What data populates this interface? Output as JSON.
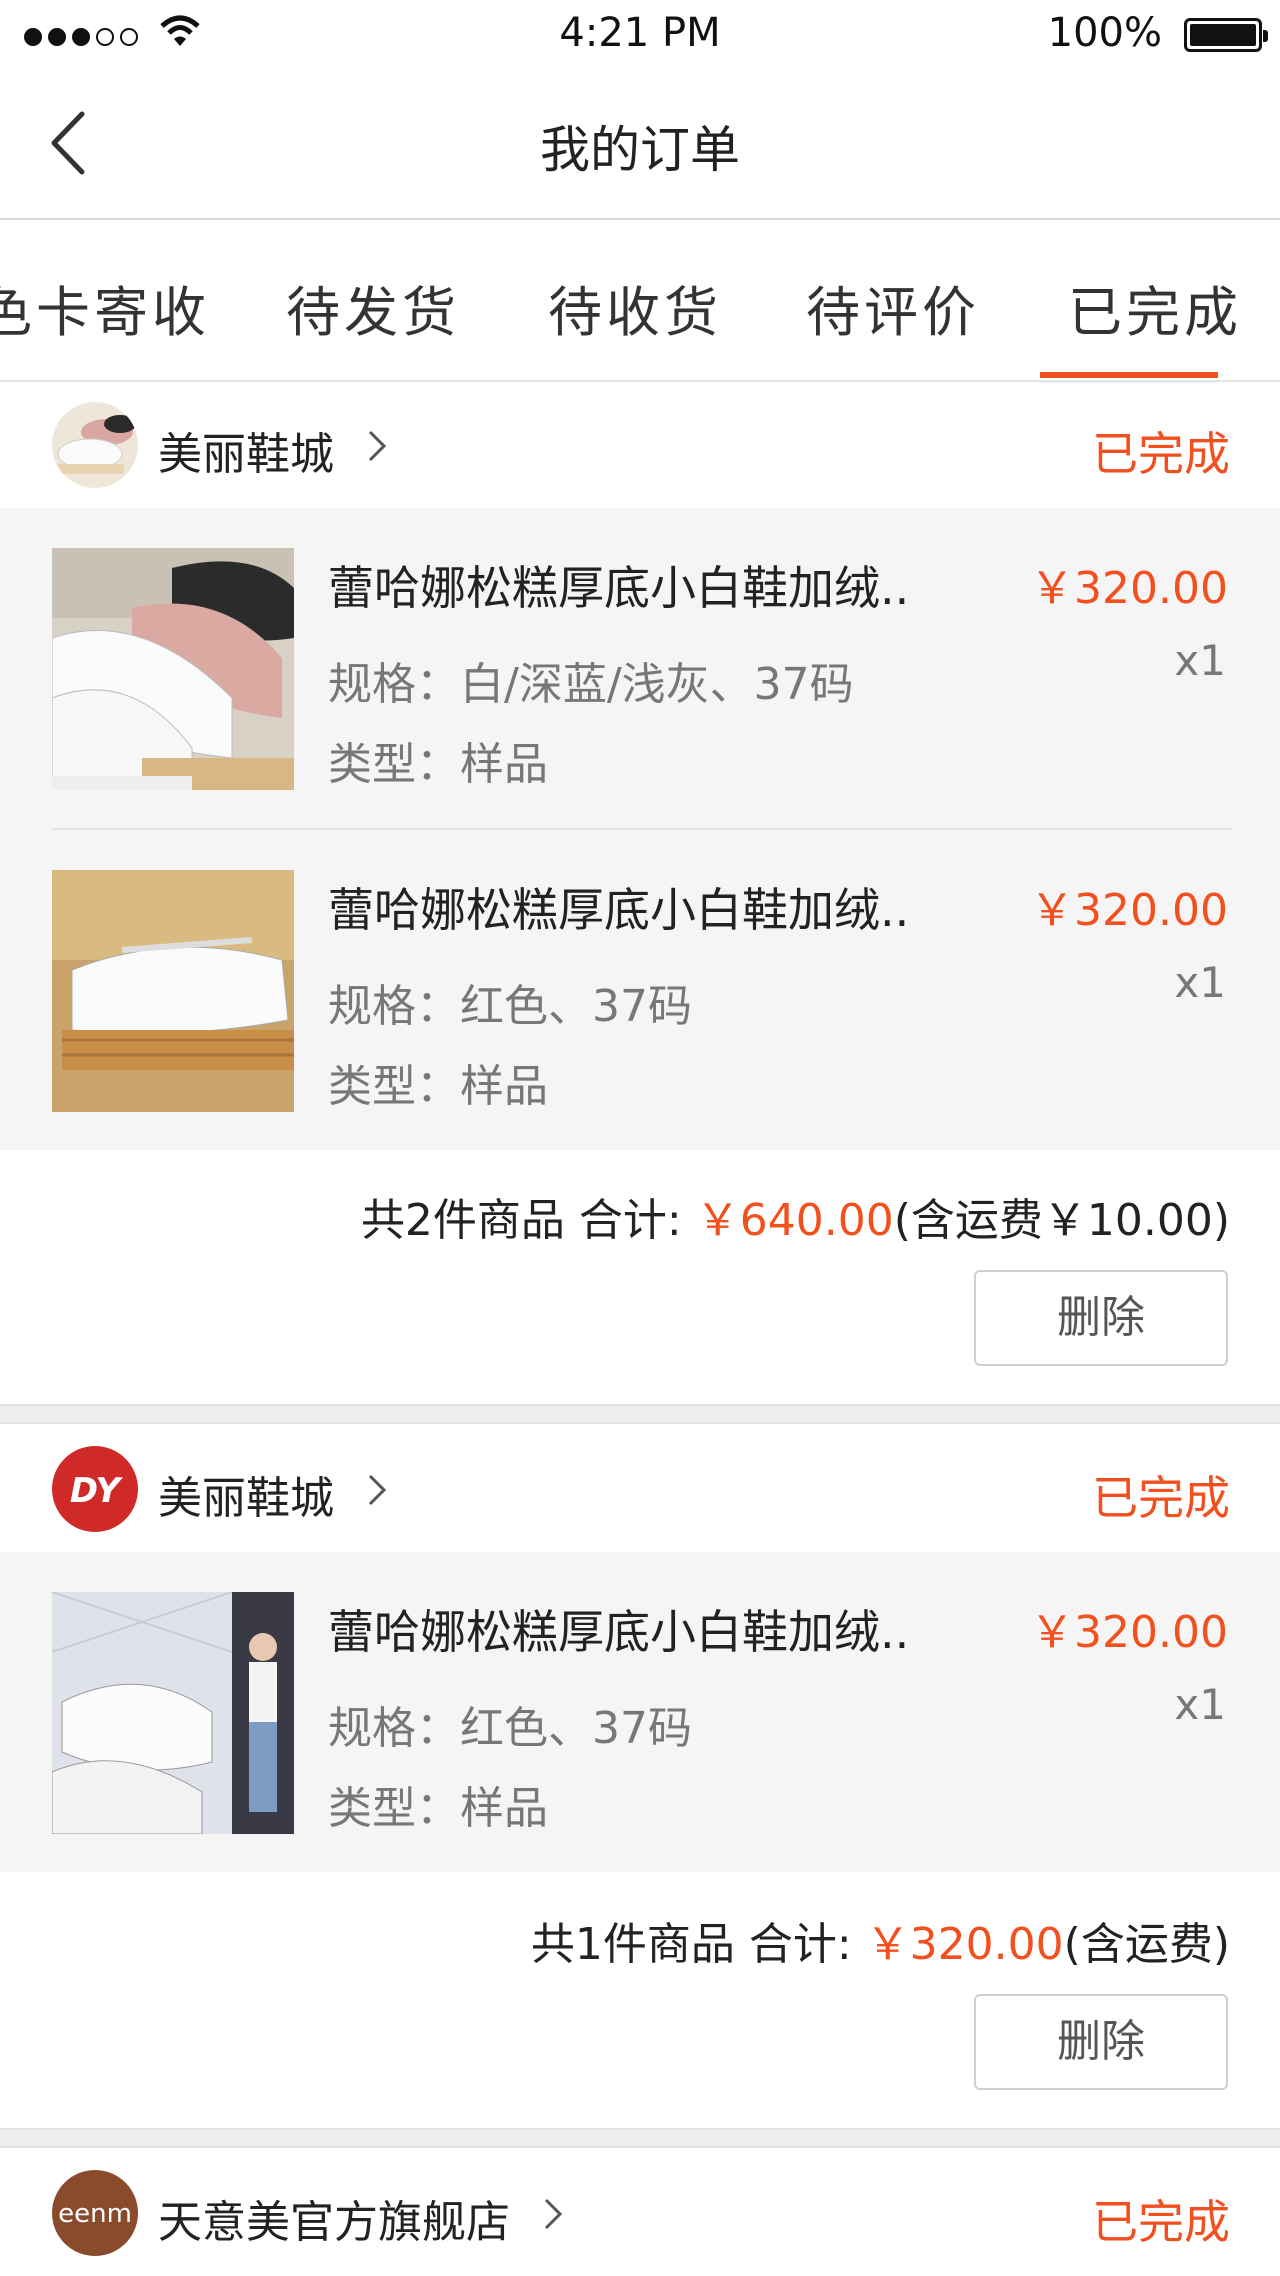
{
  "status_bar": {
    "time": "4:21 PM",
    "battery": "100%"
  },
  "nav": {
    "title": "我的订单"
  },
  "tabs": [
    {
      "label": "色卡寄收"
    },
    {
      "label": "待发货"
    },
    {
      "label": "待收货"
    },
    {
      "label": "待评价"
    },
    {
      "label": "已完成",
      "active": true
    }
  ],
  "orders": [
    {
      "shop_name": "美丽鞋城",
      "status": "已完成",
      "items": [
        {
          "title": "蕾哈娜松糕厚底小白鞋加绒..",
          "spec": "规格：白/深蓝/浅灰、37码",
          "type": "类型：样品",
          "price": "￥320.00",
          "qty": "x1"
        },
        {
          "title": "蕾哈娜松糕厚底小白鞋加绒..",
          "spec": "规格：红色、37码",
          "type": "类型：样品",
          "price": "￥320.00",
          "qty": "x1"
        }
      ],
      "summary_prefix": "共2件商品  合计: ",
      "summary_total": "￥640.00",
      "summary_suffix": "(含运费￥10.00)",
      "delete_label": "删除"
    },
    {
      "shop_name": "美丽鞋城",
      "status": "已完成",
      "items": [
        {
          "title": "蕾哈娜松糕厚底小白鞋加绒..",
          "spec": "规格：红色、37码",
          "type": "类型：样品",
          "price": "￥320.00",
          "qty": "x1"
        }
      ],
      "summary_prefix": "共1件商品  合计: ",
      "summary_total": "￥320.00",
      "summary_suffix": "(含运费)",
      "delete_label": "删除"
    },
    {
      "shop_name": "天意美官方旗舰店",
      "status": "已完成"
    }
  ],
  "colors": {
    "accent": "#f2501f",
    "items_bg": "#f5f5f5"
  }
}
